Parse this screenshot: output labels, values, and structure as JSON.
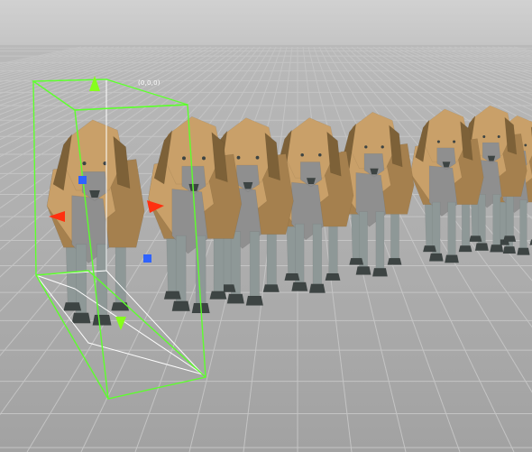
{
  "viewport": {
    "origin_label": "(0,0,0)",
    "dog_count": 8,
    "colors": {
      "sky": "#cdcdcd",
      "ground": "#a9a9a9",
      "grid_line": "#c4c4c4",
      "fur_light": "#c9a069",
      "fur_mid": "#a5804e",
      "fur_dark": "#7d6138",
      "chest": "#8f8f8f",
      "legs": "#8e9897",
      "paws": "#3d4443",
      "bbox_green": "#5dff2c",
      "bbox_white": "#ffffff",
      "axis_x": "#ff3010",
      "axis_y": "#86ff1c",
      "axis_z": "#2f63ff"
    },
    "gizmo": {
      "type": "bounding-box-handles",
      "handles": [
        "axis-x-handle",
        "axis-y-handle",
        "axis-z-handle"
      ]
    }
  }
}
